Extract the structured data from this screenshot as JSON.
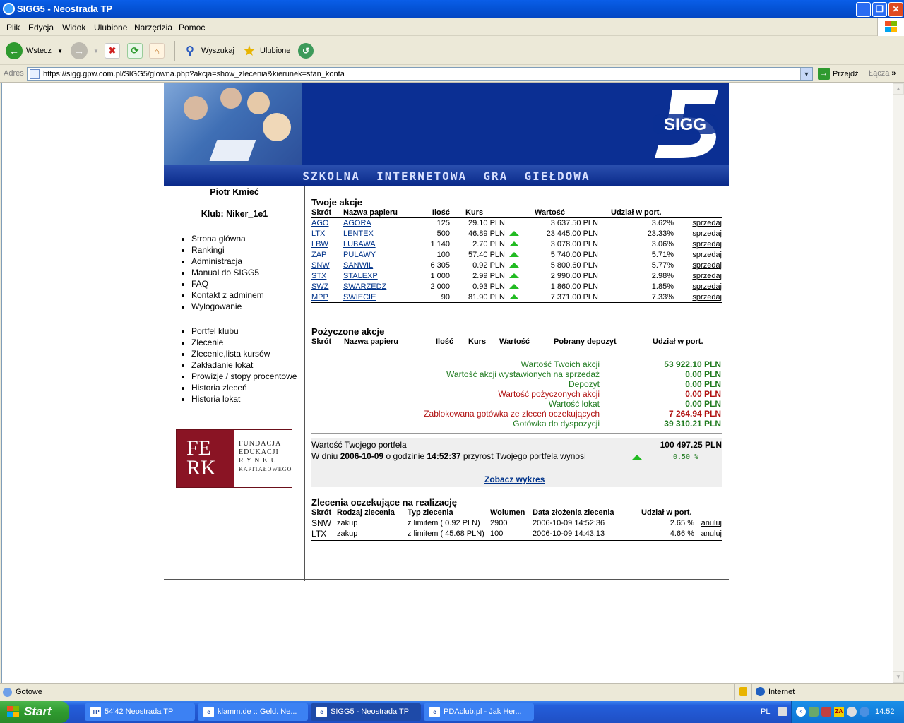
{
  "window": {
    "title": "SIGG5 - Neostrada TP"
  },
  "menu": [
    "Plik",
    "Edycja",
    "Widok",
    "Ulubione",
    "Narzędzia",
    "Pomoc"
  ],
  "toolbar": {
    "back": "Wstecz",
    "search": "Wyszukaj",
    "favorites": "Ulubione"
  },
  "address": {
    "label": "Adres",
    "url": "https://sigg.gpw.com.pl/SIGG5/glowna.php?akcja=show_zlecenia&kierunek=stan_konta",
    "go": "Przejdź",
    "links": "Łącza"
  },
  "banner": {
    "slogan": "SZKOLNA  INTERNETOWA  GRA  GIEŁDOWA",
    "logo_text": "SIGG",
    "logo_number": "5"
  },
  "sidebar": {
    "user": "Piotr Kmieć",
    "club": "Klub: Niker_1e1",
    "menu1": [
      "Strona główna",
      "Rankingi",
      "Administracja",
      "Manual do SIGG5",
      "FAQ",
      "Kontakt z adminem",
      "Wylogowanie"
    ],
    "menu2": [
      "Portfel klubu",
      "Zlecenie",
      "Zlecenie,lista kursów",
      "Zakładanie lokat",
      "Prowizje / stopy procentowe",
      "Historia zleceń",
      "Historia lokat"
    ],
    "ferk": {
      "letters": "FE\nRK",
      "line1": "FUNDACJA",
      "line2": "EDUKACJI",
      "line3": "R Y N K U",
      "line4": "KAPITAŁOWEGO"
    }
  },
  "shares": {
    "title": "Twoje akcje",
    "headers": [
      "Skrót",
      "Nazwa papieru",
      "Ilość",
      "Kurs",
      "Wartość",
      "Udział w port."
    ],
    "rows": [
      {
        "sym": "AGO",
        "name": "AGORA",
        "qty": "125",
        "price": "29.10 PLN",
        "trend": false,
        "value": "3 637.50 PLN",
        "share": "3.62%",
        "action": "sprzedaj"
      },
      {
        "sym": "LTX",
        "name": "LENTEX",
        "qty": "500",
        "price": "46.89 PLN",
        "trend": true,
        "value": "23 445.00 PLN",
        "share": "23.33%",
        "action": "sprzedaj"
      },
      {
        "sym": "LBW",
        "name": "LUBAWA",
        "qty": "1 140",
        "price": "2.70 PLN",
        "trend": true,
        "value": "3 078.00 PLN",
        "share": "3.06%",
        "action": "sprzedaj"
      },
      {
        "sym": "ZAP",
        "name": "PULAWY",
        "qty": "100",
        "price": "57.40 PLN",
        "trend": true,
        "value": "5 740.00 PLN",
        "share": "5.71%",
        "action": "sprzedaj"
      },
      {
        "sym": "SNW",
        "name": "SANWIL",
        "qty": "6 305",
        "price": "0.92 PLN",
        "trend": true,
        "value": "5 800.60 PLN",
        "share": "5.77%",
        "action": "sprzedaj"
      },
      {
        "sym": "STX",
        "name": "STALEXP",
        "qty": "1 000",
        "price": "2.99 PLN",
        "trend": true,
        "value": "2 990.00 PLN",
        "share": "2.98%",
        "action": "sprzedaj"
      },
      {
        "sym": "SWZ",
        "name": "SWARZEDZ",
        "qty": "2 000",
        "price": "0.93 PLN",
        "trend": true,
        "value": "1 860.00 PLN",
        "share": "1.85%",
        "action": "sprzedaj"
      },
      {
        "sym": "MPP",
        "name": "SWIECIE",
        "qty": "90",
        "price": "81.90 PLN",
        "trend": true,
        "value": "7 371.00 PLN",
        "share": "7.33%",
        "action": "sprzedaj"
      }
    ]
  },
  "borrowed": {
    "title": "Pożyczone akcje",
    "headers": [
      "Skrót",
      "Nazwa papieru",
      "Ilość",
      "Kurs",
      "Wartość",
      "Pobrany depozyt",
      "Udział w port."
    ]
  },
  "summary": [
    {
      "label": "Wartość Twoich akcji",
      "value": "53 922.10 PLN",
      "color": "#1f7a1f"
    },
    {
      "label": "Wartość akcji wystawionych na sprzedaż",
      "value": "0.00 PLN",
      "color": "#1f7a1f"
    },
    {
      "label": "Depozyt",
      "value": "0.00 PLN",
      "color": "#1f7a1f"
    },
    {
      "label": "Wartość pożyczonych akcji",
      "value": "0.00 PLN",
      "color": "#b01010"
    },
    {
      "label": "Wartość lokat",
      "value": "0.00 PLN",
      "color": "#1f7a1f"
    },
    {
      "label": "Zablokowana gotówka ze zleceń oczekujących",
      "value": "7 264.94 PLN",
      "color": "#b01010"
    },
    {
      "label": "Gotówka do dyspozycji",
      "value": "39 310.21 PLN",
      "color": "#1f7a1f"
    }
  ],
  "portfolio": {
    "label": "Wartość Twojego portfela",
    "value": "100 497.25 PLN",
    "w_dniu": "W dniu",
    "date": "2006-10-09",
    "o_godzinie": "o godzinie",
    "time": "14:52:37",
    "growth_text": "przyrost Twojego portfela wynosi",
    "growth": "0.50 %",
    "chart_link": "Zobacz wykres"
  },
  "pending": {
    "title": "Zlecenia oczekujące na realizację",
    "headers": [
      "Skrót",
      "Rodzaj zlecenia",
      "Typ zlecenia",
      "Wolumen",
      "Data złożenia zlecenia",
      "Udział w port."
    ],
    "rows": [
      {
        "sym": "SNW",
        "kind": "zakup",
        "type": "z limitem ( 0.92 PLN)",
        "volume": "2900",
        "date": "2006-10-09 14:52:36",
        "share": "2.65 %",
        "action": "anuluj"
      },
      {
        "sym": "LTX",
        "kind": "zakup",
        "type": "z limitem ( 45.68 PLN)",
        "volume": "100",
        "date": "2006-10-09 14:43:13",
        "share": "4.66 %",
        "action": "anuluj"
      }
    ]
  },
  "status": {
    "text": "Gotowe",
    "zone": "Internet"
  },
  "taskbar": {
    "start": "Start",
    "tasks": [
      {
        "label": "54'42 Neostrada TP",
        "icon": "TP"
      },
      {
        "label": "klamm.de :: Geld. Ne...",
        "icon": "e"
      },
      {
        "label": "SIGG5 - Neostrada TP",
        "icon": "e"
      },
      {
        "label": "PDAclub.pl - Jak Her...",
        "icon": "e"
      }
    ],
    "lang": "PL",
    "clock": "14:52"
  }
}
